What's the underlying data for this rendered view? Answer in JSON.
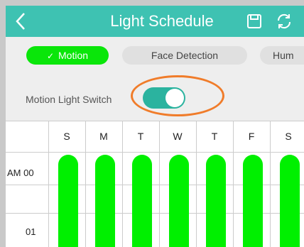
{
  "header": {
    "title": "Light Schedule",
    "background": "#3ec2b2",
    "icons": [
      "chevron-left-icon",
      "save-icon",
      "refresh-icon"
    ]
  },
  "tabs": [
    {
      "label": "Motion",
      "selected": true
    },
    {
      "label": "Face Detection",
      "selected": false
    },
    {
      "label": "Hum",
      "selected": false
    }
  ],
  "motion_switch": {
    "label": "Motion  Light Switch",
    "on": true,
    "track_color": "#2bb39f"
  },
  "schedule": {
    "days": [
      "S",
      "M",
      "T",
      "W",
      "T",
      "F",
      "S"
    ],
    "time_labels": [
      "AM 00",
      "01"
    ],
    "bar_color": "#00f000",
    "days_active": [
      true,
      true,
      true,
      true,
      true,
      true,
      true
    ]
  },
  "colors": {
    "accent": "#3ec2b2",
    "selected_tab": "#0ae60a",
    "highlight": "#f07c2a"
  }
}
